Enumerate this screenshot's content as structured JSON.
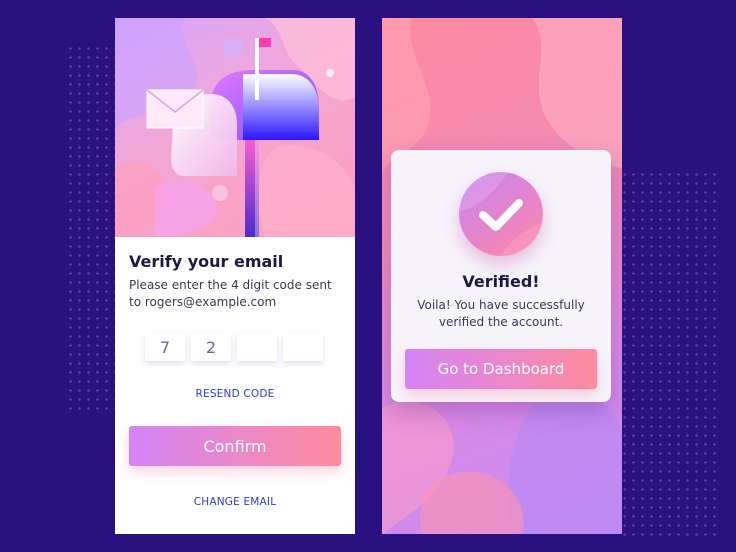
{
  "verify": {
    "title": "Verify your email",
    "description_line1": "Please enter the 4 digit code sent",
    "description_line2": "to rogers@example.com",
    "code_digits": [
      "7",
      "2",
      "",
      ""
    ],
    "resend_label": "RESEND CODE",
    "confirm_label": "Confirm",
    "change_email_label": "CHANGE EMAIL",
    "hero_icons": [
      "mailbox-icon",
      "envelope-icon",
      "flag-icon"
    ]
  },
  "verified": {
    "title": "Verified!",
    "description_line1": "Voila! You have successfully",
    "description_line2": "verified the account.",
    "button_label": "Go to Dashboard",
    "icon": "checkmark-icon"
  },
  "colors": {
    "background": "#2a1180",
    "accent_start": "#d484f7",
    "accent_end": "#ff8b9e",
    "link": "#2b3bd0",
    "heading": "#1c1a44"
  }
}
